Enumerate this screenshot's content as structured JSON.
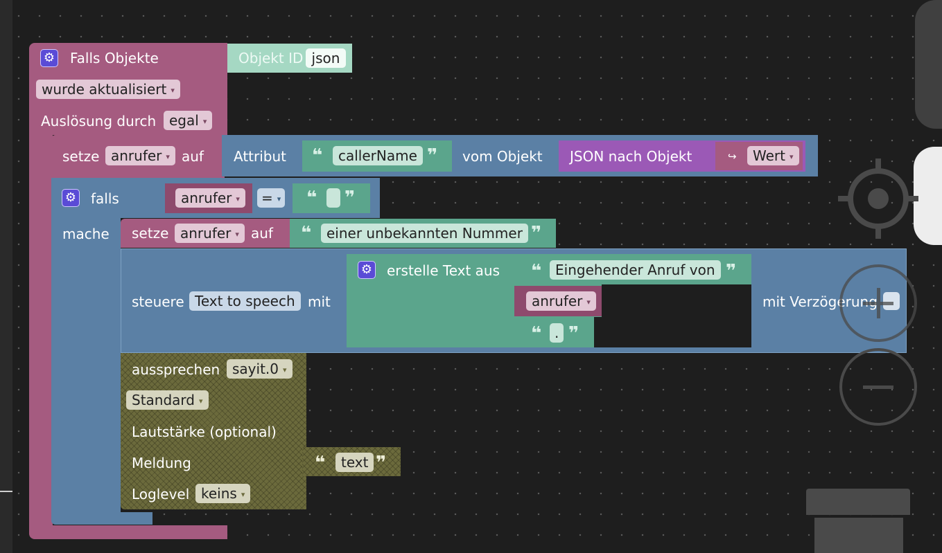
{
  "trigger": {
    "title": "Falls Objekte",
    "object_id_label": "Objekt ID",
    "object_id_value": "json",
    "event": "wurde aktualisiert",
    "cause_label": "Auslösung durch",
    "cause_value": "egal"
  },
  "set_block_1": {
    "set_label": "setze",
    "variable": "anrufer",
    "to_label": "auf",
    "attribute_label": "Attribut",
    "attribute_value": "callerName",
    "from_object_label": "vom Objekt",
    "json_label": "JSON nach Objekt",
    "value_arrow": "↪",
    "value_label": "Wert"
  },
  "if_block": {
    "if_label": "falls",
    "do_label": "mache",
    "variable": "anrufer",
    "operator": "=",
    "compare_value": ""
  },
  "set_block_2": {
    "set_label": "setze",
    "variable": "anrufer",
    "to_label": "auf",
    "text_value": "einer unbekannten Nummer"
  },
  "control_block": {
    "control_label": "steuere",
    "target": "Text to speech",
    "with_label": "mit",
    "create_text_label": "erstelle Text aus",
    "text_part_1": "Eingehender Anruf von",
    "text_part_2": "anrufer",
    "text_part_3": ".",
    "delay_label": "mit Verzögerung"
  },
  "say_block": {
    "say_label": "aussprechen",
    "instance": "sayit.0",
    "mode": "Standard",
    "volume_label": "Lautstärke (optional)",
    "message_label": "Meldung",
    "message_value": "text",
    "loglevel_label": "Loglevel",
    "loglevel_value": "keins"
  },
  "icons": {
    "gear": "⚙",
    "dropdown_arrow": "▾",
    "quote_open": "❝",
    "quote_close": "❞"
  },
  "colors": {
    "workspace": "#1e1e1e",
    "event_block": "#a55b80",
    "logic_block": "#5b80a5",
    "text_block": "#5ba58c",
    "json_block": "#9b59b6",
    "speech_block": "#6b6a3c"
  }
}
